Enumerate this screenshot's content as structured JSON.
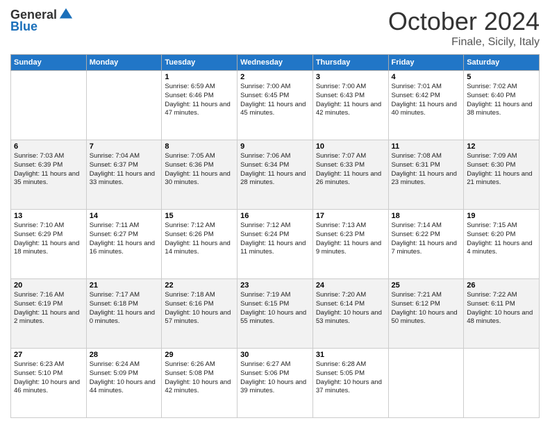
{
  "logo": {
    "general": "General",
    "blue": "Blue"
  },
  "header": {
    "month": "October 2024",
    "location": "Finale, Sicily, Italy"
  },
  "weekdays": [
    "Sunday",
    "Monday",
    "Tuesday",
    "Wednesday",
    "Thursday",
    "Friday",
    "Saturday"
  ],
  "weeks": [
    [
      {
        "day": "",
        "sunrise": "",
        "sunset": "",
        "daylight": ""
      },
      {
        "day": "",
        "sunrise": "",
        "sunset": "",
        "daylight": ""
      },
      {
        "day": "1",
        "sunrise": "Sunrise: 6:59 AM",
        "sunset": "Sunset: 6:46 PM",
        "daylight": "Daylight: 11 hours and 47 minutes."
      },
      {
        "day": "2",
        "sunrise": "Sunrise: 7:00 AM",
        "sunset": "Sunset: 6:45 PM",
        "daylight": "Daylight: 11 hours and 45 minutes."
      },
      {
        "day": "3",
        "sunrise": "Sunrise: 7:00 AM",
        "sunset": "Sunset: 6:43 PM",
        "daylight": "Daylight: 11 hours and 42 minutes."
      },
      {
        "day": "4",
        "sunrise": "Sunrise: 7:01 AM",
        "sunset": "Sunset: 6:42 PM",
        "daylight": "Daylight: 11 hours and 40 minutes."
      },
      {
        "day": "5",
        "sunrise": "Sunrise: 7:02 AM",
        "sunset": "Sunset: 6:40 PM",
        "daylight": "Daylight: 11 hours and 38 minutes."
      }
    ],
    [
      {
        "day": "6",
        "sunrise": "Sunrise: 7:03 AM",
        "sunset": "Sunset: 6:39 PM",
        "daylight": "Daylight: 11 hours and 35 minutes."
      },
      {
        "day": "7",
        "sunrise": "Sunrise: 7:04 AM",
        "sunset": "Sunset: 6:37 PM",
        "daylight": "Daylight: 11 hours and 33 minutes."
      },
      {
        "day": "8",
        "sunrise": "Sunrise: 7:05 AM",
        "sunset": "Sunset: 6:36 PM",
        "daylight": "Daylight: 11 hours and 30 minutes."
      },
      {
        "day": "9",
        "sunrise": "Sunrise: 7:06 AM",
        "sunset": "Sunset: 6:34 PM",
        "daylight": "Daylight: 11 hours and 28 minutes."
      },
      {
        "day": "10",
        "sunrise": "Sunrise: 7:07 AM",
        "sunset": "Sunset: 6:33 PM",
        "daylight": "Daylight: 11 hours and 26 minutes."
      },
      {
        "day": "11",
        "sunrise": "Sunrise: 7:08 AM",
        "sunset": "Sunset: 6:31 PM",
        "daylight": "Daylight: 11 hours and 23 minutes."
      },
      {
        "day": "12",
        "sunrise": "Sunrise: 7:09 AM",
        "sunset": "Sunset: 6:30 PM",
        "daylight": "Daylight: 11 hours and 21 minutes."
      }
    ],
    [
      {
        "day": "13",
        "sunrise": "Sunrise: 7:10 AM",
        "sunset": "Sunset: 6:29 PM",
        "daylight": "Daylight: 11 hours and 18 minutes."
      },
      {
        "day": "14",
        "sunrise": "Sunrise: 7:11 AM",
        "sunset": "Sunset: 6:27 PM",
        "daylight": "Daylight: 11 hours and 16 minutes."
      },
      {
        "day": "15",
        "sunrise": "Sunrise: 7:12 AM",
        "sunset": "Sunset: 6:26 PM",
        "daylight": "Daylight: 11 hours and 14 minutes."
      },
      {
        "day": "16",
        "sunrise": "Sunrise: 7:12 AM",
        "sunset": "Sunset: 6:24 PM",
        "daylight": "Daylight: 11 hours and 11 minutes."
      },
      {
        "day": "17",
        "sunrise": "Sunrise: 7:13 AM",
        "sunset": "Sunset: 6:23 PM",
        "daylight": "Daylight: 11 hours and 9 minutes."
      },
      {
        "day": "18",
        "sunrise": "Sunrise: 7:14 AM",
        "sunset": "Sunset: 6:22 PM",
        "daylight": "Daylight: 11 hours and 7 minutes."
      },
      {
        "day": "19",
        "sunrise": "Sunrise: 7:15 AM",
        "sunset": "Sunset: 6:20 PM",
        "daylight": "Daylight: 11 hours and 4 minutes."
      }
    ],
    [
      {
        "day": "20",
        "sunrise": "Sunrise: 7:16 AM",
        "sunset": "Sunset: 6:19 PM",
        "daylight": "Daylight: 11 hours and 2 minutes."
      },
      {
        "day": "21",
        "sunrise": "Sunrise: 7:17 AM",
        "sunset": "Sunset: 6:18 PM",
        "daylight": "Daylight: 11 hours and 0 minutes."
      },
      {
        "day": "22",
        "sunrise": "Sunrise: 7:18 AM",
        "sunset": "Sunset: 6:16 PM",
        "daylight": "Daylight: 10 hours and 57 minutes."
      },
      {
        "day": "23",
        "sunrise": "Sunrise: 7:19 AM",
        "sunset": "Sunset: 6:15 PM",
        "daylight": "Daylight: 10 hours and 55 minutes."
      },
      {
        "day": "24",
        "sunrise": "Sunrise: 7:20 AM",
        "sunset": "Sunset: 6:14 PM",
        "daylight": "Daylight: 10 hours and 53 minutes."
      },
      {
        "day": "25",
        "sunrise": "Sunrise: 7:21 AM",
        "sunset": "Sunset: 6:12 PM",
        "daylight": "Daylight: 10 hours and 50 minutes."
      },
      {
        "day": "26",
        "sunrise": "Sunrise: 7:22 AM",
        "sunset": "Sunset: 6:11 PM",
        "daylight": "Daylight: 10 hours and 48 minutes."
      }
    ],
    [
      {
        "day": "27",
        "sunrise": "Sunrise: 6:23 AM",
        "sunset": "Sunset: 5:10 PM",
        "daylight": "Daylight: 10 hours and 46 minutes."
      },
      {
        "day": "28",
        "sunrise": "Sunrise: 6:24 AM",
        "sunset": "Sunset: 5:09 PM",
        "daylight": "Daylight: 10 hours and 44 minutes."
      },
      {
        "day": "29",
        "sunrise": "Sunrise: 6:26 AM",
        "sunset": "Sunset: 5:08 PM",
        "daylight": "Daylight: 10 hours and 42 minutes."
      },
      {
        "day": "30",
        "sunrise": "Sunrise: 6:27 AM",
        "sunset": "Sunset: 5:06 PM",
        "daylight": "Daylight: 10 hours and 39 minutes."
      },
      {
        "day": "31",
        "sunrise": "Sunrise: 6:28 AM",
        "sunset": "Sunset: 5:05 PM",
        "daylight": "Daylight: 10 hours and 37 minutes."
      },
      {
        "day": "",
        "sunrise": "",
        "sunset": "",
        "daylight": ""
      },
      {
        "day": "",
        "sunrise": "",
        "sunset": "",
        "daylight": ""
      }
    ]
  ]
}
